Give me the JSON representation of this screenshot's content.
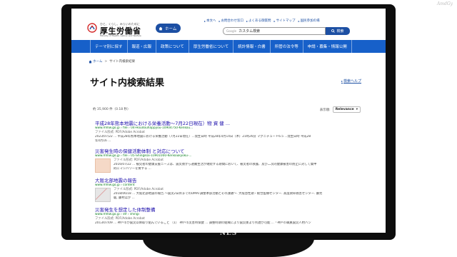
{
  "frame": {
    "brand": "NES",
    "corner_mark": "AmdGy"
  },
  "header": {
    "logo_tagline": "ひと、くらし、みらいのために",
    "logo_name": "厚生労働省",
    "logo_en": "Ministry of Health, Labour and Welfare",
    "home_button": "ホーム",
    "util_links": [
      "本文へ",
      "お問合わせ窓口",
      "よくある御質問",
      "サイトマップ",
      "国民参加の場"
    ],
    "search_engine_label": "Google",
    "search_placeholder": "カスタム検索",
    "search_button": "検索"
  },
  "nav": {
    "items": [
      "テーマ別に探す",
      "報道・広報",
      "政策について",
      "厚生労働省について",
      "統計情報・白書",
      "所管の法令等",
      "申請・募集・情報公開"
    ]
  },
  "breadcrumb": {
    "home": "ホーム",
    "separator": ">",
    "current": "サイト内検索結果"
  },
  "page": {
    "title": "サイト内検索結果",
    "help_link": "検索ヘルプ",
    "results_count": "約 35,900 件（0.18 秒）",
    "order_label": "表示順:",
    "order_value": "Relevance"
  },
  "results": [
    {
      "title": "平成28年熊本地震における栄養活動〜7月22日現在）物 資 健 ...",
      "url": "www.mhlw.go.jp › file › 04-Houdouhappyou-10904750-Kenkou...",
      "filetype": "ファイル形式: PDF/Adobe Acrobat",
      "snippet": [
        "2023/07/22 ... 平成28年熊本地震における栄養活動（7月22日現在）...発生日時 平成28年4月14日（木）21時26分 マグニチュード6.5 ...発生日時 平成28",
        "年4月16 ..."
      ]
    },
    {
      "title": "災害発生時の保健活動体制 と対応について",
      "url": "www.mhlw.go.jp › file › 05-Shingikai-10901000-Kenkoukyoku-...",
      "filetype": "ファイル形式: PDF/Adobe Acrobat",
      "snippet": [
        "2016/07/22 ... 被災者の健康支援ニーズは、震災後から避難生活が継続する期間において、被災者の救護、及び二次的健康被害の防止に対して集中",
        "的にマンパワーを要する ..."
      ]
    },
    {
      "title": "大阪北部地震の報告",
      "url": "www.mhlw.go.jp › content",
      "filetype": "ファイル形式: PDF/Adobe Acrobat",
      "snippet": [
        "2018/06/18 ... 大阪北部地震の報告.〜震災2日目までのDMAT調整本部活動とその課題〜. 大阪急性期・総合医療センター. 高度救命救急センター. 藤見",
        "聡, 藤村ほか ..."
      ]
    },
    {
      "title": "災害発生を想定した体制整備",
      "url": "www.mhlw.go.jp › stf › shingi",
      "filetype": "ファイル形式: PDF/Adobe Acrobat",
      "snippet": [
        "2013/07/09 ... 神戸市が震災以降取り組んでいること （1） 神戸市災害時保健 ... 調整時期の組織により震災後より所遅が可能 ...「神戸市職員震災人材バン",
        ""
      ]
    }
  ],
  "colors": {
    "accent": "#1c4fa3",
    "nav_bg": "#1760c9",
    "link": "#1a0dab",
    "url": "#0b7d1f"
  }
}
